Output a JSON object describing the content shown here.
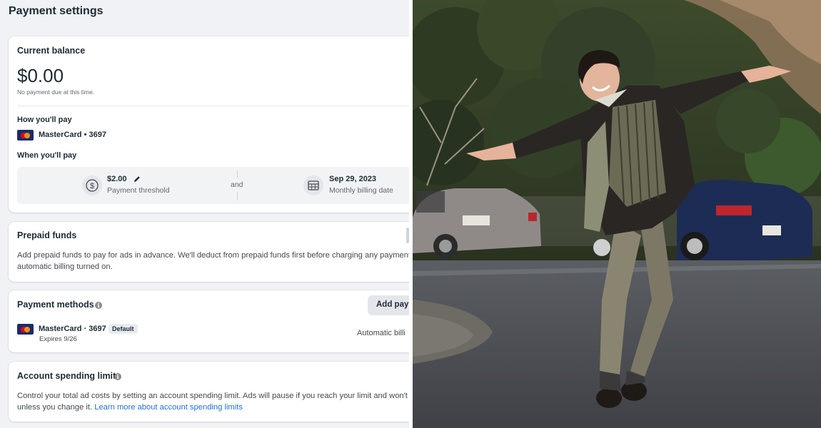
{
  "page": {
    "title": "Payment settings"
  },
  "balance": {
    "title": "Current balance",
    "amount": "$0.00",
    "note": "No payment due at this time."
  },
  "how_pay": {
    "label": "How you'll pay",
    "card": "MasterCard • 3697"
  },
  "when_pay": {
    "label": "When you'll pay",
    "threshold_value": "$2.00",
    "threshold_label": "Payment threshold",
    "conjunction": "and",
    "billing_date": "Sep 29, 2023",
    "billing_label": "Monthly billing date"
  },
  "prepaid": {
    "title": "Prepaid funds",
    "line1": "Add prepaid funds to pay for ads in advance. We'll deduct from prepaid funds first before charging any payment m",
    "line2": "automatic billing turned on."
  },
  "methods": {
    "title": "Payment methods",
    "add_button": "Add paym",
    "card": "MasterCard · 3697",
    "badge": "Default",
    "expires": "Expires 9/26",
    "billing_status": "Automatic billi"
  },
  "spending": {
    "title": "Account spending limit",
    "line1": "Control your total ad costs by setting an account spending limit. Ads will pause if you reach your limit and won't ru",
    "line2_prefix": "unless you change it.",
    "link": "Learn more about account spending limits"
  },
  "icons": {
    "pencil": "pencil-icon",
    "dollar": "dollar-circle-icon",
    "calendar": "calendar-icon",
    "info": "info-icon",
    "card": "mastercard-icon"
  },
  "colors": {
    "link": "#216fdb",
    "mastercard_red": "#eb001b",
    "mastercard_orange": "#f79e1b",
    "card_navy": "#1a2b6d"
  }
}
